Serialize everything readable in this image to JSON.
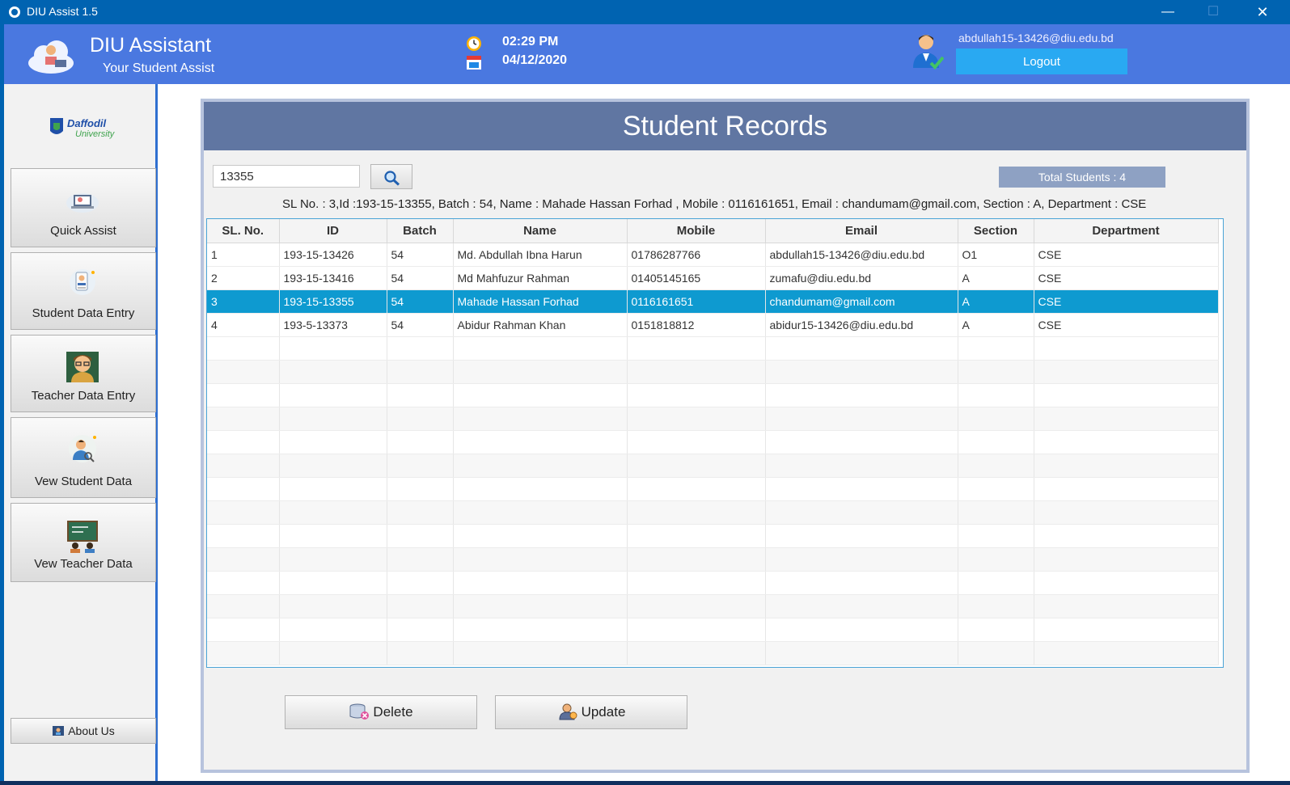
{
  "window": {
    "title": "DIU Assist 1.5",
    "minimize": "—",
    "maximize": "☐",
    "close": "✕"
  },
  "header": {
    "app_name": "DIU Assistant",
    "tagline": "Your Student Assist",
    "time": "02:29 PM",
    "date": "04/12/2020",
    "user_email": "abdullah15-13426@diu.edu.bd",
    "logout_label": "Logout"
  },
  "sidebar": {
    "logo_text_1": "Daffodil",
    "logo_text_2": "University",
    "items": [
      {
        "label": "Quick Assist",
        "icon": "laptop-assist-icon"
      },
      {
        "label": "Student Data Entry",
        "icon": "student-id-icon"
      },
      {
        "label": "Teacher Data Entry",
        "icon": "teacher-icon"
      },
      {
        "label": "Vew Student Data",
        "icon": "student-search-icon"
      },
      {
        "label": "Vew Teacher Data",
        "icon": "classroom-board-icon"
      }
    ],
    "about_label": "About Us"
  },
  "main": {
    "panel_title": "Student Records",
    "search": {
      "value": "13355",
      "icon": "search-icon"
    },
    "total_students": "Total Students : 4",
    "detail_line": "SL No. : 3,Id :193-15-13355, Batch : 54, Name : Mahade Hassan Forhad , Mobile : 0116161651, Email : chandumam@gmail.com, Section : A, Department : CSE",
    "table": {
      "columns": [
        "SL. No.",
        "ID",
        "Batch",
        "Name",
        "Mobile",
        "Email",
        "Section",
        "Department"
      ],
      "rows": [
        [
          "1",
          "193-15-13426",
          "54",
          "Md. Abdullah Ibna Harun",
          "01786287766",
          "abdullah15-13426@diu.edu.bd",
          "O1",
          "CSE"
        ],
        [
          "2",
          "193-15-13416",
          "54",
          "Md Mahfuzur Rahman",
          "01405145165",
          "zumafu@diu.edu.bd",
          "A",
          "CSE"
        ],
        [
          "3",
          "193-15-13355",
          "54",
          "Mahade Hassan Forhad",
          "0116161651",
          "chandumam@gmail.com",
          "A",
          "CSE"
        ],
        [
          "4",
          "193-5-13373",
          "54",
          " Abidur Rahman Khan",
          "0151818812",
          "abidur15-13426@diu.edu.bd",
          "A",
          "CSE"
        ]
      ],
      "selected_row": 3
    },
    "delete_label": "Delete",
    "update_label": "Update"
  },
  "colors": {
    "titlebar": "#0063b1",
    "header": "#4a78e0",
    "panel_header": "#6076a2",
    "selection": "#0e9ad0",
    "logout": "#29a9f2"
  }
}
